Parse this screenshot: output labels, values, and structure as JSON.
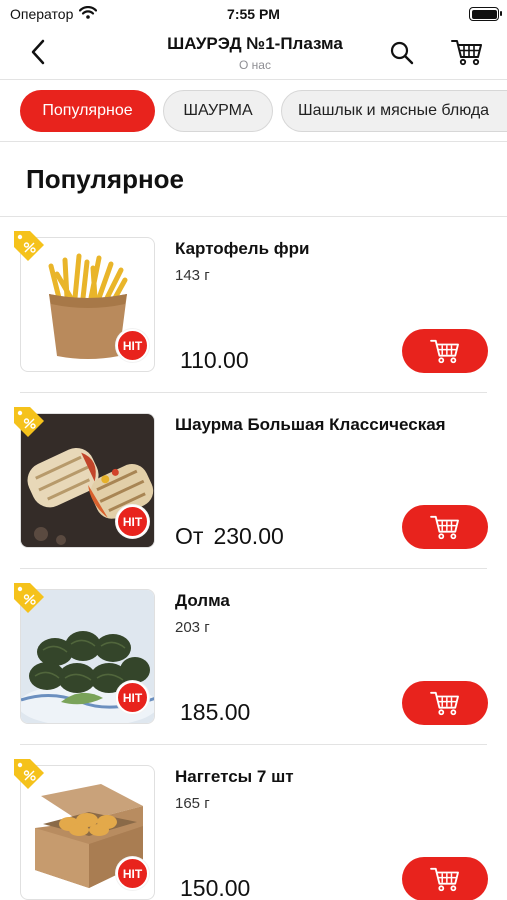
{
  "status_bar": {
    "carrier": "Оператор",
    "time": "7:55 PM"
  },
  "header": {
    "title": "ШАУРЭД №1-Плазма",
    "subtitle": "О нас"
  },
  "tabs": [
    {
      "label": "Популярное",
      "active": true
    },
    {
      "label": "ШАУРМА",
      "active": false
    },
    {
      "label": "Шашлык и мясные блюда",
      "active": false
    }
  ],
  "section": {
    "title": "Популярное"
  },
  "items": [
    {
      "name": "Картофель фри",
      "weight": "143 г",
      "price_prefix": "",
      "price": "110.00",
      "badge": "HIT"
    },
    {
      "name": "Шаурма Большая Классическая",
      "weight": "",
      "price_prefix": "От",
      "price": "230.00",
      "badge": "HIT"
    },
    {
      "name": "Долма",
      "weight": "203 г",
      "price_prefix": "",
      "price": "185.00",
      "badge": "HIT"
    },
    {
      "name": "Наггетсы 7 шт",
      "weight": "165 г",
      "price_prefix": "",
      "price": "150.00",
      "badge": "HIT"
    }
  ],
  "colors": {
    "accent": "#e8231d",
    "discount_tag": "#f5c21b",
    "separator": "#e3e3e3"
  },
  "icons": [
    "wifi-icon",
    "battery-icon",
    "back-chevron-icon",
    "search-icon",
    "cart-icon",
    "discount-tag-icon",
    "add-to-cart-icon"
  ]
}
